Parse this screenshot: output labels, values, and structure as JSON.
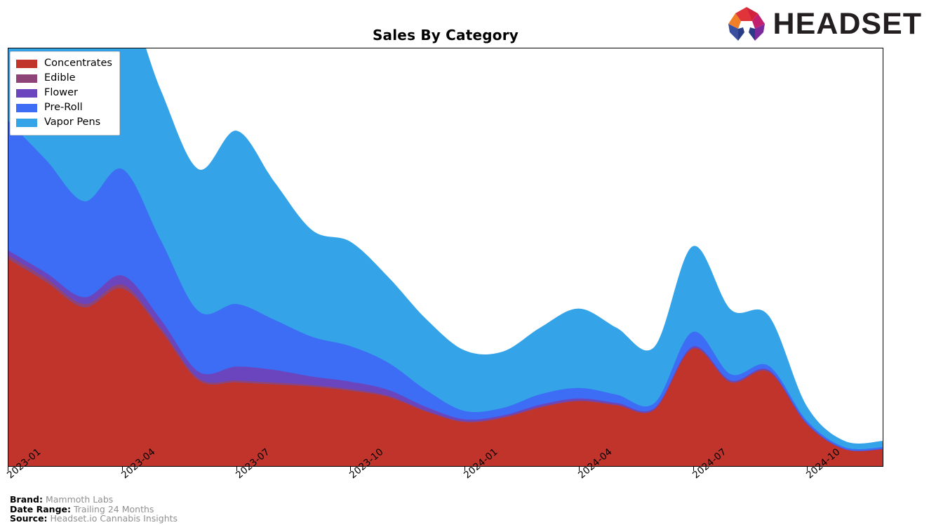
{
  "header": {
    "title": "Sales By Category",
    "logo_text": "HEADSET",
    "logo_mark_name": "headset-arch-logo"
  },
  "legend": {
    "position": "upper-left",
    "items": [
      {
        "label": "Concentrates",
        "color": "#c0342c"
      },
      {
        "label": "Edible",
        "color": "#8e4476"
      },
      {
        "label": "Flower",
        "color": "#6a45bd"
      },
      {
        "label": "Pre-Roll",
        "color": "#3d6cf5"
      },
      {
        "label": "Vapor Pens",
        "color": "#34a3e8"
      }
    ]
  },
  "footer": {
    "rows": [
      {
        "key": "Brand:",
        "value": "Mammoth Labs"
      },
      {
        "key": "Date Range:",
        "value": "Trailing 24 Months"
      },
      {
        "key": "Source:",
        "value": "Headset.io Cannabis Insights"
      }
    ]
  },
  "chart_data": {
    "type": "area",
    "stacked": true,
    "title": "Sales By Category",
    "xlabel": "",
    "ylabel": "",
    "grid": false,
    "legend_position": "upper-left",
    "axis": {
      "x_tick_labels": [
        "2023-01",
        "2023-04",
        "2023-07",
        "2023-10",
        "2024-01",
        "2024-04",
        "2024-07",
        "2024-10"
      ],
      "x_tick_positions": [
        0,
        3,
        6,
        9,
        12,
        15,
        18,
        21
      ],
      "y_tick_labels": [],
      "ylim": [
        0,
        100
      ]
    },
    "x": [
      "2023-01",
      "2023-02",
      "2023-03",
      "2023-04",
      "2023-05",
      "2023-06",
      "2023-07",
      "2023-08",
      "2023-09",
      "2023-10",
      "2023-11",
      "2023-12",
      "2024-01",
      "2024-02",
      "2024-03",
      "2024-04",
      "2024-05",
      "2024-06",
      "2024-07",
      "2024-08",
      "2024-09",
      "2024-10",
      "2024-11",
      "2024-12"
    ],
    "series": [
      {
        "name": "Concentrates",
        "color": "#c0342c",
        "values": [
          49.5,
          44.0,
          38.0,
          42.5,
          32.5,
          20.5,
          20.0,
          19.5,
          19.0,
          18.0,
          16.5,
          13.0,
          10.5,
          11.5,
          14.0,
          15.5,
          14.5,
          13.5,
          28.0,
          20.0,
          22.5,
          10.0,
          4.0,
          4.0
        ]
      },
      {
        "name": "Edible",
        "color": "#8e4476",
        "values": [
          0.9,
          0.9,
          0.8,
          0.9,
          0.7,
          0.5,
          0.5,
          0.5,
          0.4,
          0.4,
          0.3,
          0.2,
          0.2,
          0.2,
          0.2,
          0.2,
          0.2,
          0.1,
          0.2,
          0.2,
          0.2,
          0.1,
          0.0,
          0.0
        ]
      },
      {
        "name": "Flower",
        "color": "#6a45bd",
        "values": [
          1.2,
          1.3,
          1.6,
          2.2,
          2.0,
          1.6,
          3.3,
          3.0,
          2.0,
          1.8,
          1.4,
          0.9,
          0.5,
          0.4,
          0.5,
          0.5,
          0.4,
          0.3,
          0.4,
          0.3,
          0.3,
          0.2,
          0.1,
          0.1
        ]
      },
      {
        "name": "Pre-Roll",
        "color": "#3d6cf5",
        "values": [
          31.0,
          27.0,
          23.0,
          25.5,
          19.0,
          14.5,
          15.0,
          12.0,
          9.5,
          8.5,
          6.5,
          4.0,
          2.0,
          1.8,
          2.5,
          2.5,
          2.0,
          1.2,
          3.5,
          1.5,
          1.0,
          0.6,
          0.4,
          0.4
        ]
      },
      {
        "name": "Vapor Pens",
        "color": "#34a3e8",
        "values": [
          49.0,
          46.0,
          41.0,
          42.0,
          36.0,
          34.0,
          41.5,
          33.0,
          25.5,
          25.0,
          20.5,
          17.0,
          14.5,
          13.5,
          16.0,
          19.0,
          16.0,
          13.5,
          20.5,
          15.5,
          12.0,
          3.5,
          1.5,
          1.5
        ]
      }
    ]
  }
}
